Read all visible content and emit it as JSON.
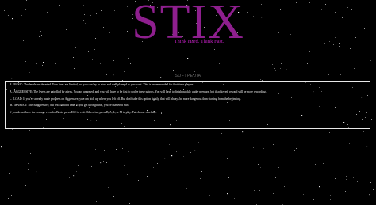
{
  "game": {
    "title": "STIX",
    "tagline": "Think Hard.  Think Fast.",
    "watermark": "SOFTPEDIA"
  },
  "menu": {
    "modes": [
      {
        "key": "B.",
        "text": "BASIC: The levels are deserted. Your lives are limited, but you can lay as slow and well planned as you want. This is recommended for first-time players."
      },
      {
        "key": "A.",
        "text": "AGGRESSIVE: The levels are patrolled by aliens. You are unarmed, and you will have to be fast to dodge these patrols. You will have to finish quickly under pressure, but if achieved, reward will be more rewarding."
      },
      {
        "key": "L.",
        "text": "LOAD: If you've already made progress on Aggressive, you can pick up where you left off. But don't take this option lightly, that will always be more dangerous than starting from the beginning."
      },
      {
        "key": "M.",
        "text": "MASTER: This is aggressive, but with limited time. If you get through this, you've mastered Stix."
      }
    ],
    "note": "If you do not have the courage even for Basic, press ESC to exit. Otherwise, press B, A, L, or M to play. Put choose carefully."
  }
}
